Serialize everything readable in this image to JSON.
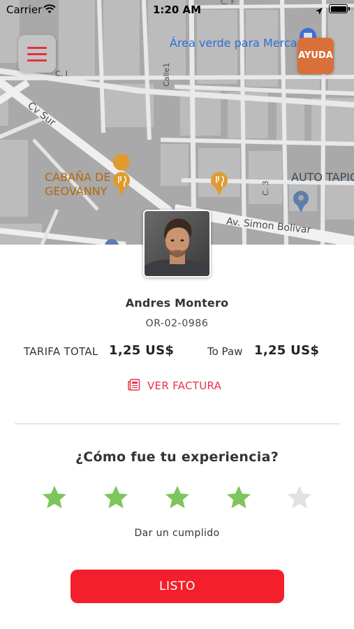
{
  "status_bar": {
    "carrier": "Carrier",
    "time": "1:20 AM"
  },
  "map": {
    "street_labels": {
      "cv_sur": "Cv Sur",
      "c1": "C. I",
      "calle1": "Calle1",
      "c3": "C. 3",
      "cf": "C. F",
      "simon_bolivar": "Av. Simon Bolivar"
    },
    "places": {
      "cabana_line1": "CABAÑA DE",
      "cabana_line2": "GEOVANNY",
      "area_verde": "Área verde para Mercado",
      "auto_tapic": "AUTO TAPIC"
    },
    "colors": {
      "background": "#a9a9a9",
      "block": "#bdbdbd",
      "restaurant_pin": "#e09a2e",
      "blue_pin": "#5b7fa8"
    }
  },
  "menu_button": {
    "icon": "hamburger-icon",
    "color": "#e8303a"
  },
  "help_button": {
    "label": "AYUDA",
    "color": "#d9703a"
  },
  "driver": {
    "name": "Andres Montero",
    "plate": "OR-02-0986"
  },
  "fare": {
    "total_label": "TARIFA TOTAL",
    "total_value": "1,25 US$",
    "to_paw_label": "To Paw",
    "to_paw_value": "1,25 US$"
  },
  "invoice": {
    "label": "VER FACTURA",
    "icon": "receipt-icon",
    "color": "#e8334a"
  },
  "rating": {
    "question": "¿Cómo fue tu experiencia?",
    "value": 4,
    "max": 5,
    "filled_color": "#7dc55c",
    "empty_color": "#e1e1e1"
  },
  "compliment_label": "Dar un cumplido",
  "done_button": {
    "label": "LISTO",
    "color": "#f31f2a"
  }
}
